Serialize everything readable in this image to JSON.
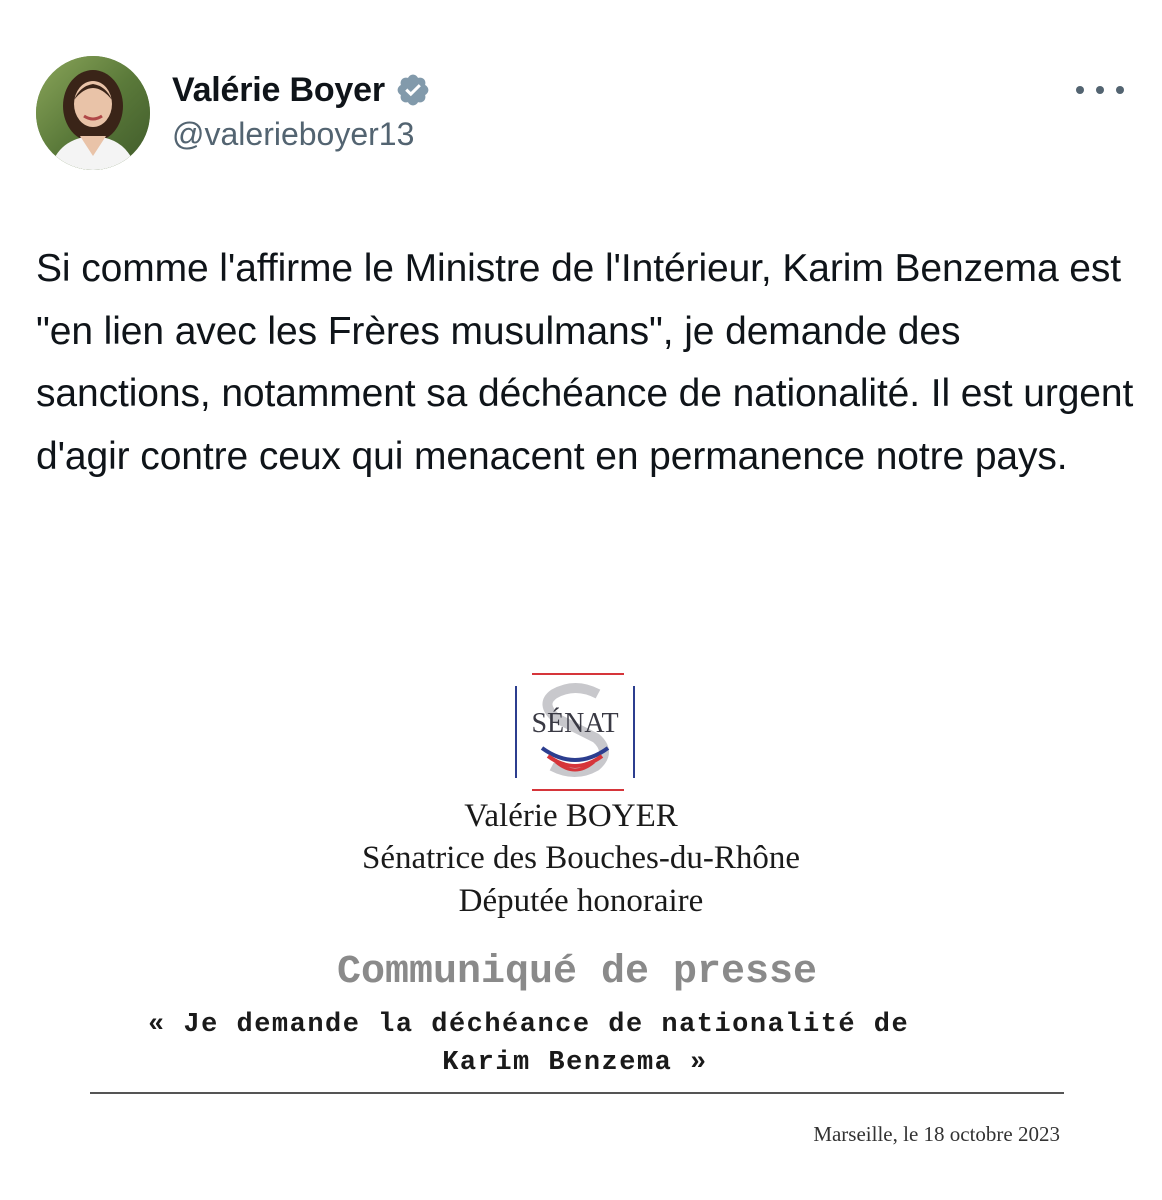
{
  "author": {
    "display_name": "Valérie Boyer",
    "handle": "@valerieboyer13",
    "avatar_icon": "profile-photo",
    "verified_icon": "verified-badge-icon",
    "verified_color": "#829aab"
  },
  "more_icon": "more-options-icon",
  "tweet": {
    "text": "Si comme l'affirme le Ministre de l'Intérieur, Karim Benzema est \"en lien avec les Frères musulmans\", je demande des sanctions, notamment sa déchéance de nationalité. Il est urgent d'agir contre ceux qui menacent en permanence notre pays."
  },
  "document": {
    "logo_text": "SÉNAT",
    "logo_colors": {
      "red": "#d6353a",
      "blue": "#2c3e8f"
    },
    "name": "Valérie BOYER",
    "title_line1": "Sénatrice des Bouches-du-Rhône",
    "title_line2": "Députée honoraire",
    "heading": "Communiqué de presse",
    "quote_line1": "« Je demande la déchéance de nationalité de",
    "quote_line2": "Karim Benzema »",
    "date": "Marseille, le 18 octobre 2023"
  }
}
